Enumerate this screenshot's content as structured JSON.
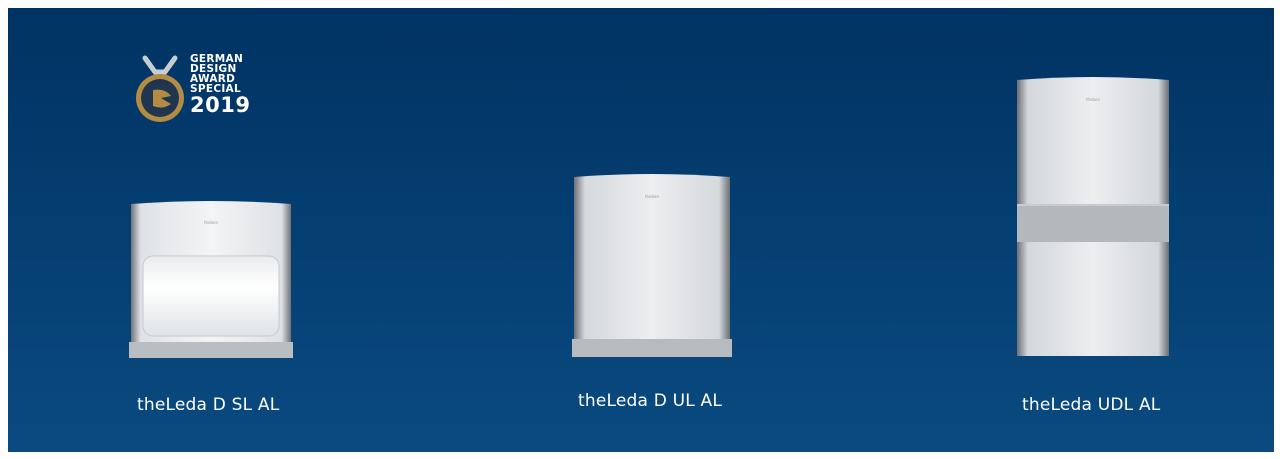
{
  "award": {
    "line1": "GERMAN",
    "line2": "DESIGN",
    "line3": "AWARD",
    "line4": "SPECIAL",
    "year": "2019",
    "medal_color": "#b38b42"
  },
  "products": [
    {
      "name": "theLeda D SL AL",
      "brand": "theben"
    },
    {
      "name": "theLeda D UL AL",
      "brand": "theben"
    },
    {
      "name": "theLeda UDL AL",
      "brand": "theben"
    }
  ],
  "colors": {
    "background_top": "#003363",
    "background_bottom": "#0a4a80",
    "text": "#ffffff"
  }
}
